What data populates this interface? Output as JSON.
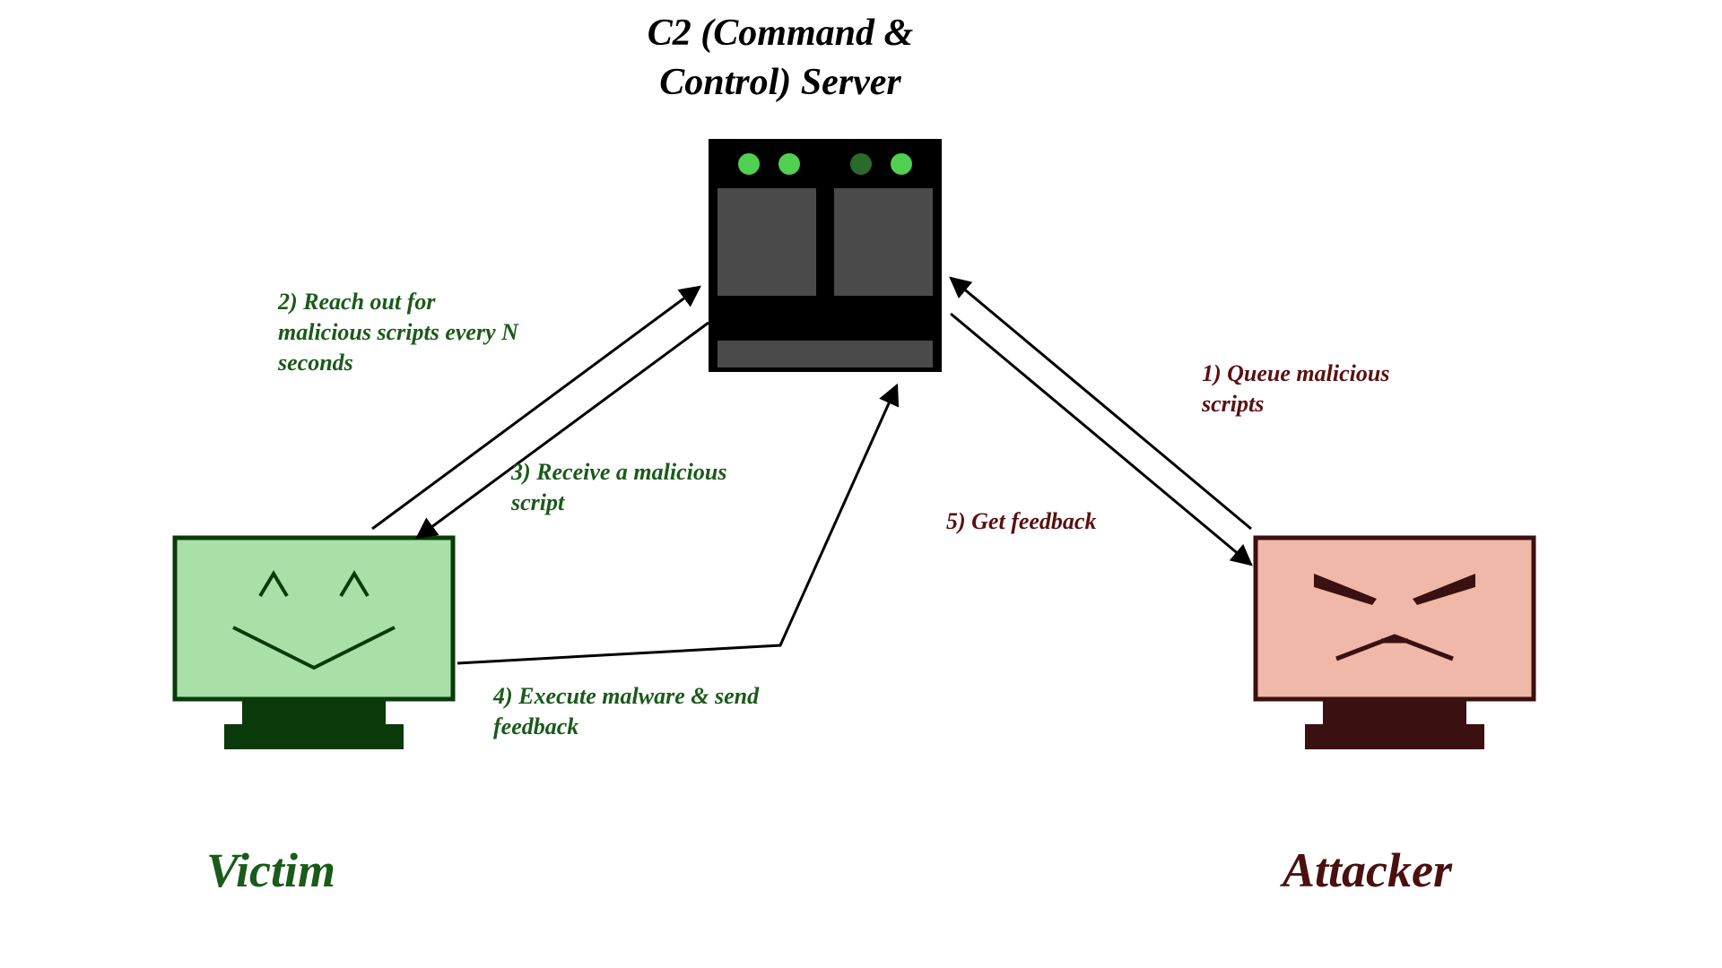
{
  "title_line1": "C2 (Command &",
  "title_line2": "Control) Server",
  "victim_label": "Victim",
  "attacker_label": "Attacker",
  "steps": {
    "s1": "1) Queue malicious scripts",
    "s2": "2) Reach out for malicious scripts every N seconds",
    "s3": "3) Receive a malicious script",
    "s4": "4) Execute malware & send feedback",
    "s5": "5) Get feedback"
  },
  "colors": {
    "victim_fill": "#a8e0a8",
    "victim_stroke": "#0a3a0a",
    "attacker_fill": "#f0b8a8",
    "attacker_stroke": "#3a1010",
    "server_dark": "#000000",
    "server_gray": "#4a4a4a",
    "server_led_on": "#50d050",
    "server_led_dim": "#2a6a2a"
  }
}
